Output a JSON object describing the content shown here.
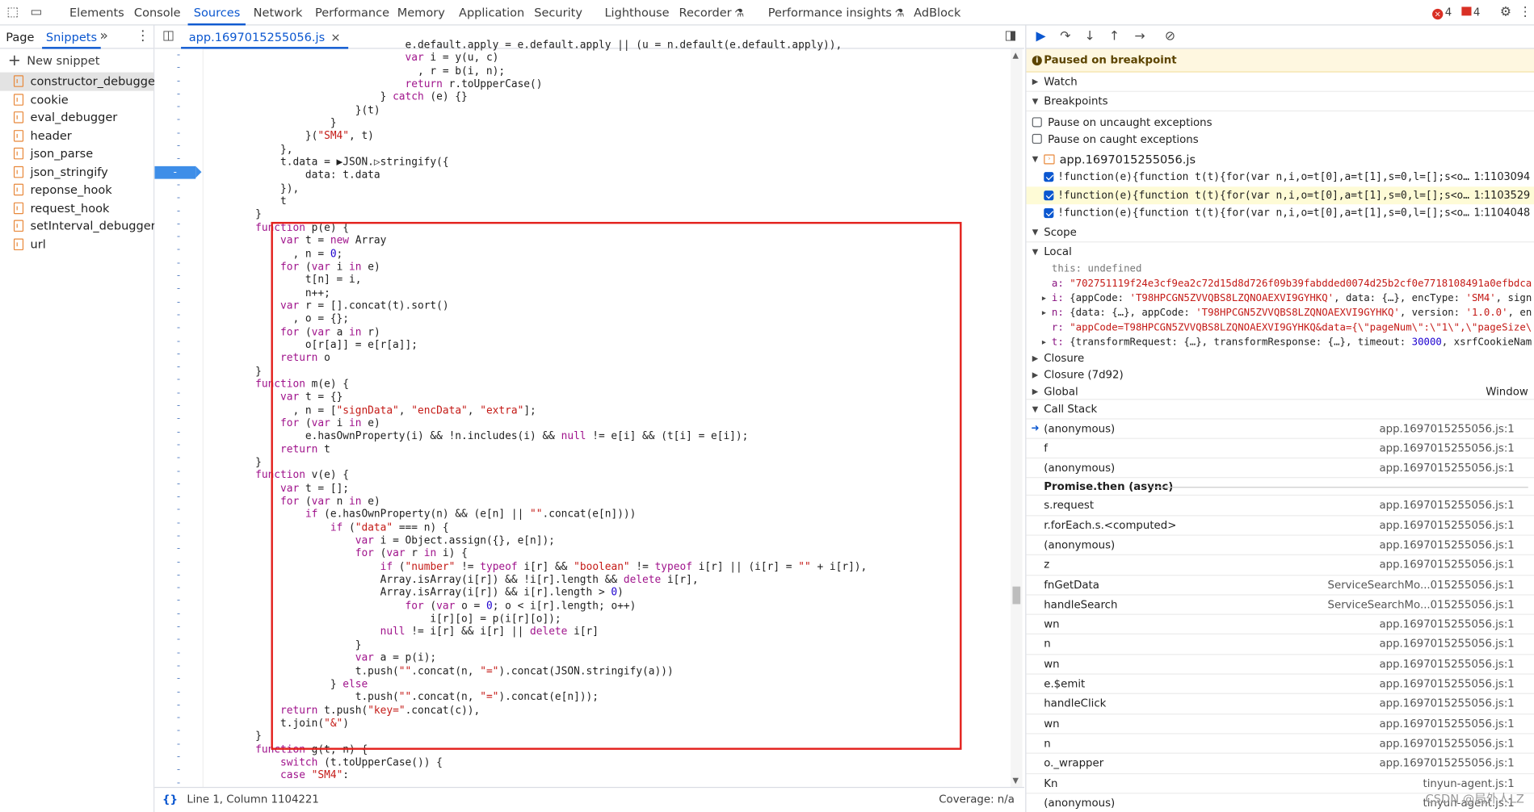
{
  "topbar": {
    "tabs": [
      "Elements",
      "Console",
      "Sources",
      "Network",
      "Performance",
      "Memory",
      "Application",
      "Security",
      "Lighthouse",
      "Recorder",
      "Performance insights",
      "AdBlock"
    ],
    "active_tab": "Sources",
    "errors_count": "4",
    "warnings_count": "4"
  },
  "navigator": {
    "tab_page": "Page",
    "tab_snippets": "Snippets",
    "more": "»",
    "new_snippet": "New snippet",
    "snippets": [
      "constructor_debugger",
      "cookie",
      "eval_debugger",
      "header",
      "json_parse",
      "json_stringify",
      "reponse_hook",
      "request_hook",
      "setInterval_debugger",
      "url"
    ],
    "selected": "constructor_debugger"
  },
  "editor": {
    "file_tab": "app.1697015255056.js",
    "close": "×",
    "status_position": "Line 1, Column 1104221",
    "coverage": "Coverage: n/a",
    "format_icon": "{}"
  },
  "debugger": {
    "paused_message": "Paused on breakpoint",
    "sections": {
      "watch": "Watch",
      "breakpoints": "Breakpoints",
      "scope": "Scope",
      "call_stack": "Call Stack"
    },
    "pause_uncaught": "Pause on uncaught exceptions",
    "pause_caught": "Pause on caught exceptions",
    "bp_file": "app.1697015255056.js",
    "breakpoints": [
      {
        "code": "!function(e){function t(t){for(var n,i,o=t[0],a=t[1],s=0,l=[];s<o…",
        "line": "1:1103094"
      },
      {
        "code": "!function(e){function t(t){for(var n,i,o=t[0],a=t[1],s=0,l=[];s<o…",
        "line": "1:1103529"
      },
      {
        "code": "!function(e){function t(t){for(var n,i,o=t[0],a=t[1],s=0,l=[];s<o…",
        "line": "1:1104048"
      }
    ],
    "scope": {
      "local": "Local",
      "this_key": "this:",
      "this_val": "undefined",
      "a_key": "a:",
      "a_val": "\"702751119f24e3cf9ea2c72d15d8d726f09b39fabdded0074d25b2cf0e7718108491a0efbdca",
      "i_key": "i:",
      "i_val1": "{appCode: ",
      "i_val2": "'T98HPCGN5ZVVQBS8LZQNOAEXVI9GYHKQ'",
      "i_val3": ", data: {…}, encType: ",
      "i_val4": "'SM4'",
      "i_val5": ", sign",
      "n_key": "n:",
      "n_val1": "{data: {…}, appCode: ",
      "n_val2": "'T98HPCGN5ZVVQBS8LZQNOAEXVI9GYHKQ'",
      "n_val3": ", version: ",
      "n_val4": "'1.0.0'",
      "n_val5": ", en",
      "r_key": "r:",
      "r_val": "\"appCode=T98HPCGN5ZVVQBS8LZQNOAEXVI9GYHKQ&data={\\\"pageNum\\\":\\\"1\\\",\\\"pageSize\\",
      "t_key": "t:",
      "t_val1": "{transformRequest: {…}, transformResponse: {…}, timeout: ",
      "t_val2": "30000",
      "t_val3": ", xsrfCookieNam",
      "closure": "Closure",
      "closure2": "Closure (7d92)",
      "global": "Global",
      "global_val": "Window"
    },
    "call_stack": [
      {
        "fn": "(anonymous)",
        "loc": "app.1697015255056.js:1",
        "current": true
      },
      {
        "fn": "f",
        "loc": "app.1697015255056.js:1"
      },
      {
        "fn": "(anonymous)",
        "loc": "app.1697015255056.js:1"
      },
      {
        "async": "Promise.then (async)"
      },
      {
        "fn": "s.request",
        "loc": "app.1697015255056.js:1"
      },
      {
        "fn": "r.forEach.s.<computed>",
        "loc": "app.1697015255056.js:1"
      },
      {
        "fn": "(anonymous)",
        "loc": "app.1697015255056.js:1"
      },
      {
        "fn": "z",
        "loc": "app.1697015255056.js:1"
      },
      {
        "fn": "fnGetData",
        "loc": "ServiceSearchMo...015255056.js:1"
      },
      {
        "fn": "handleSearch",
        "loc": "ServiceSearchMo...015255056.js:1"
      },
      {
        "fn": "wn",
        "loc": "app.1697015255056.js:1"
      },
      {
        "fn": "n",
        "loc": "app.1697015255056.js:1"
      },
      {
        "fn": "wn",
        "loc": "app.1697015255056.js:1"
      },
      {
        "fn": "e.$emit",
        "loc": "app.1697015255056.js:1"
      },
      {
        "fn": "handleClick",
        "loc": "app.1697015255056.js:1"
      },
      {
        "fn": "wn",
        "loc": "app.1697015255056.js:1"
      },
      {
        "fn": "n",
        "loc": "app.1697015255056.js:1"
      },
      {
        "fn": "o._wrapper",
        "loc": "app.1697015255056.js:1"
      },
      {
        "fn": "Kn",
        "loc": "tinyun-agent.js:1"
      },
      {
        "fn": "(anonymous)",
        "loc": "tinyun-agent.js:1"
      }
    ],
    "watermark": "CSDN @局外人LZ"
  },
  "code_lines": [
    "                                e.default.apply = e.default.apply || (u = n.default(e.default.apply)),",
    "                                var i = y(u, c)",
    "                                  , r = b(i, n);",
    "                                return r.toUpperCase()",
    "                            } catch (e) {}",
    "                        }(t)",
    "                    }",
    "                }(\"SM4\", t)",
    "            },",
    "            t.data = ▶JSON.▷stringify({",
    "                data: t.data",
    "            }),",
    "            t",
    "        }",
    "        function p(e) {",
    "            var t = new Array",
    "              , n = 0;",
    "            for (var i in e)",
    "                t[n] = i,",
    "                n++;",
    "            var r = [].concat(t).sort()",
    "              , o = {};",
    "            for (var a in r)",
    "                o[r[a]] = e[r[a]];",
    "            return o",
    "        }",
    "        function m(e) {",
    "            var t = {}",
    "              , n = [\"signData\", \"encData\", \"extra\"];",
    "            for (var i in e)",
    "                e.hasOwnProperty(i) && !n.includes(i) && null != e[i] && (t[i] = e[i]);",
    "            return t",
    "        }",
    "        function v(e) {",
    "            var t = [];",
    "            for (var n in e)",
    "                if (e.hasOwnProperty(n) && (e[n] || \"\".concat(e[n])))",
    "                    if (\"data\" === n) {",
    "                        var i = Object.assign({}, e[n]);",
    "                        for (var r in i) {",
    "                            if (\"number\" != typeof i[r] && \"boolean\" != typeof i[r] || (i[r] = \"\" + i[r]),",
    "                            Array.isArray(i[r]) && !i[r].length && delete i[r],",
    "                            Array.isArray(i[r]) && i[r].length > 0)",
    "                                for (var o = 0; o < i[r].length; o++)",
    "                                    i[r][o] = p(i[r][o]);",
    "                            null != i[r] && i[r] || delete i[r]",
    "                        }",
    "                        var a = p(i);",
    "                        t.push(\"\".concat(n, \"=\").concat(JSON.stringify(a)))",
    "                    } else",
    "                        t.push(\"\".concat(n, \"=\").concat(e[n]));",
    "            return t.push(\"key=\".concat(c)),",
    "            t.join(\"&\")",
    "        }",
    "        function g(t, n) {",
    "            switch (t.toUpperCase()) {",
    "            case \"SM4\":"
  ],
  "gutter_marker": "-"
}
